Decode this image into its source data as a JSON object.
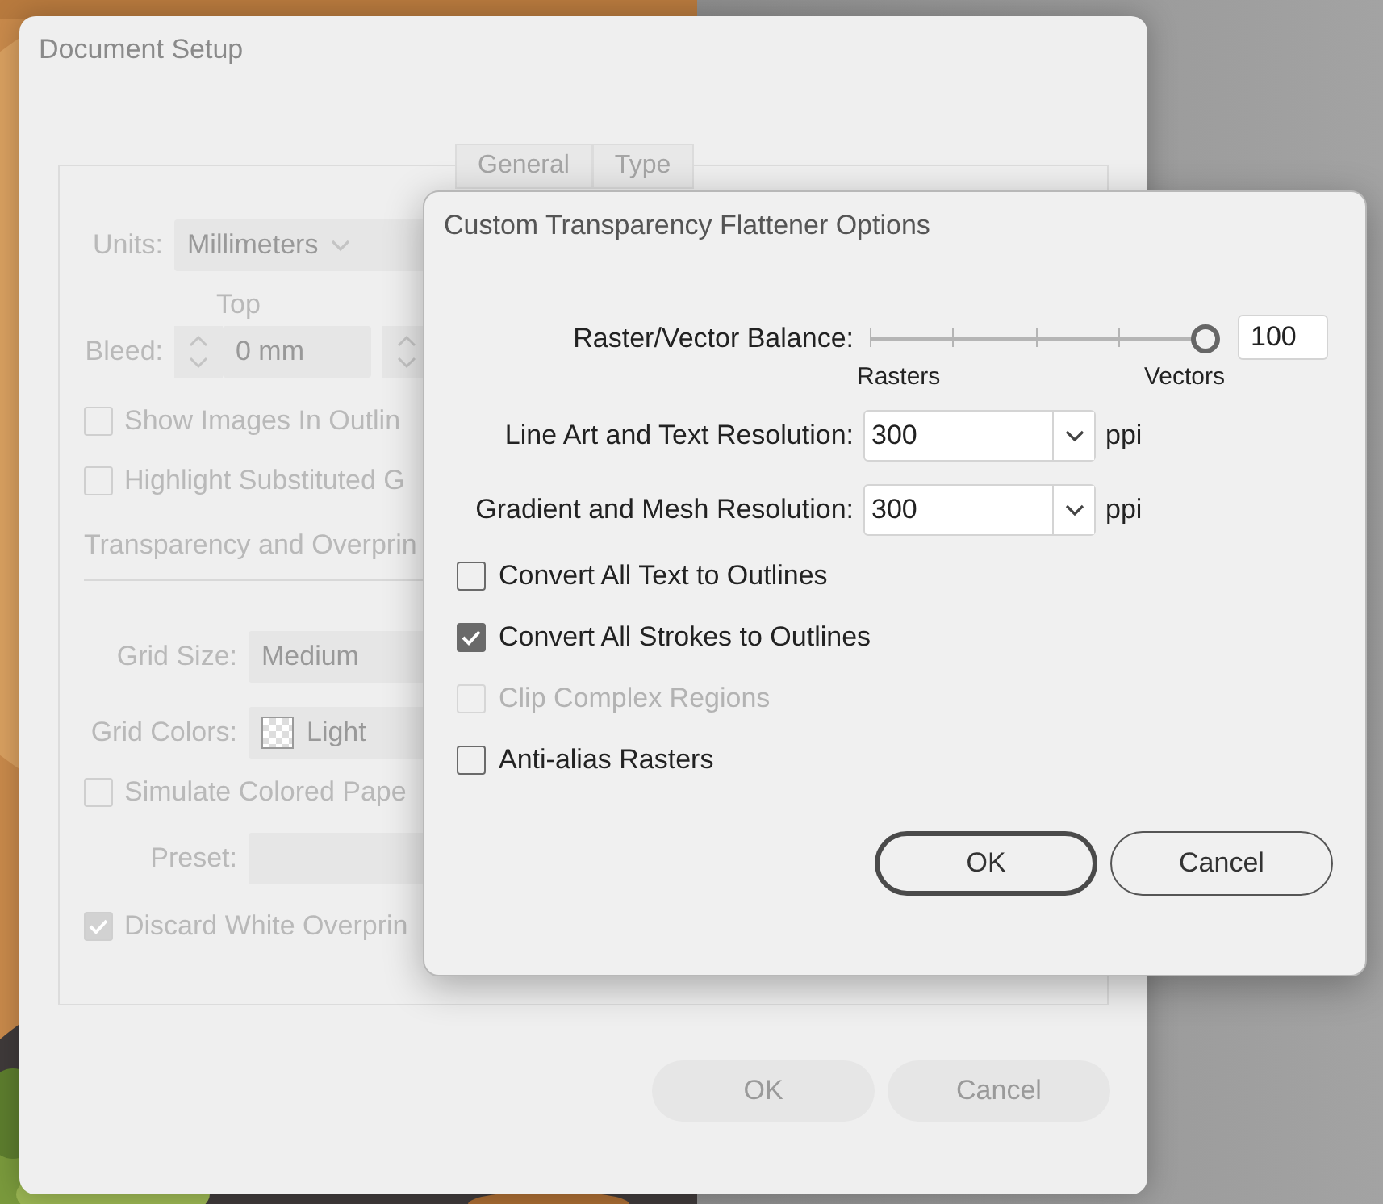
{
  "back_dialog": {
    "title": "Document Setup",
    "tabs": [
      "General",
      "Type"
    ],
    "rows": [
      {
        "kind": "select",
        "label": "Units:",
        "value": "Millimeters"
      },
      {
        "kind": "spinner",
        "caption": "Top",
        "label": "Bleed:",
        "value": "0 mm"
      },
      {
        "kind": "checkbox",
        "label": "Show Images In Outlin",
        "checked": false
      },
      {
        "kind": "checkbox",
        "label": "Highlight Substituted G",
        "checked": false
      },
      {
        "kind": "heading",
        "label": "Transparency and Overprin"
      },
      {
        "kind": "select",
        "label": "Grid Size:",
        "value": "Medium"
      },
      {
        "kind": "swatch",
        "label": "Grid Colors:",
        "value": "Light"
      },
      {
        "kind": "checkbox",
        "label": "Simulate Colored Pape",
        "checked": false
      },
      {
        "kind": "select",
        "label": "Preset:"
      },
      {
        "kind": "checkbox",
        "label": "Discard White Overprin",
        "checked": true
      }
    ],
    "buttons": [
      "OK",
      "Cancel"
    ]
  },
  "front_dialog": {
    "title": "Custom Transparency Flattener Options",
    "balance": {
      "label": "Raster/Vector Balance:",
      "level": 1,
      "value": "100",
      "min_label": "Rasters",
      "max_label": "Vectors"
    },
    "resolutions": [
      {
        "label": "Line Art and Text Resolution:",
        "value": "300",
        "unit": "ppi"
      },
      {
        "label": "Gradient and Mesh Resolution:",
        "value": "300",
        "unit": "ppi"
      }
    ],
    "options": [
      {
        "label": "Convert All Text to Outlines",
        "checked": false,
        "disabled": false
      },
      {
        "label": "Convert All Strokes to Outlines",
        "checked": true,
        "disabled": false
      },
      {
        "label": "Clip Complex Regions",
        "checked": false,
        "disabled": true
      },
      {
        "label": "Anti-alias Rasters",
        "checked": false,
        "disabled": false
      }
    ],
    "buttons": [
      {
        "label": "OK",
        "default": true
      },
      {
        "label": "Cancel",
        "default": false
      }
    ]
  }
}
